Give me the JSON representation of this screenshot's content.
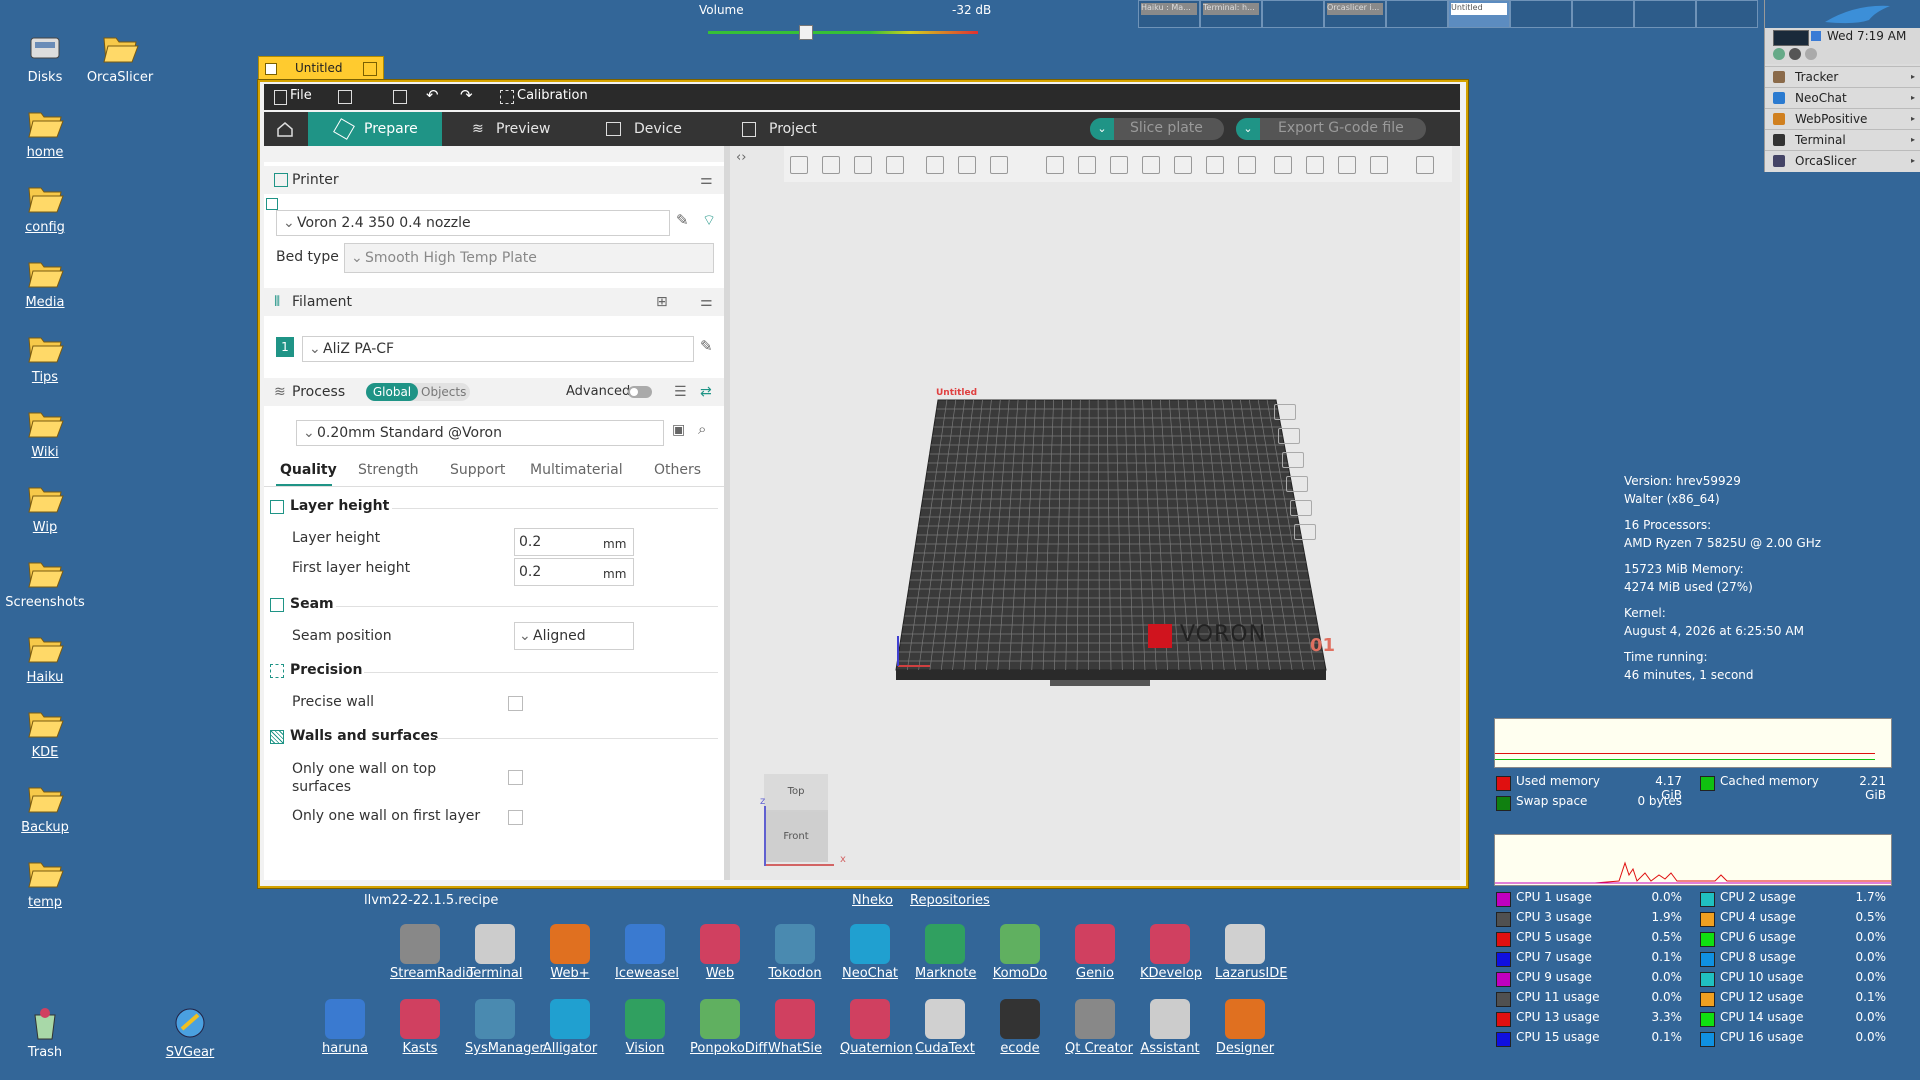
{
  "desktop": {
    "icons": [
      {
        "label": "Disks",
        "underline": false,
        "icon": "disk-icon"
      },
      {
        "label": "OrcaSlicer",
        "underline": false,
        "icon": "folder-icon"
      },
      {
        "label": "home",
        "underline": true,
        "icon": "folder-icon"
      },
      {
        "label": "config",
        "underline": true,
        "icon": "folder-icon"
      },
      {
        "label": "Media",
        "underline": true,
        "icon": "folder-icon"
      },
      {
        "label": "Tips",
        "underline": true,
        "icon": "folder-icon"
      },
      {
        "label": "Wiki",
        "underline": true,
        "icon": "folder-icon"
      },
      {
        "label": "Wip",
        "underline": true,
        "icon": "folder-icon"
      },
      {
        "label": "Screenshots",
        "underline": false,
        "icon": "folder-icon"
      },
      {
        "label": "Haiku",
        "underline": true,
        "icon": "folder-icon"
      },
      {
        "label": "KDE",
        "underline": true,
        "icon": "folder-icon"
      },
      {
        "label": "Backup",
        "underline": true,
        "icon": "folder-icon"
      },
      {
        "label": "temp",
        "underline": true,
        "icon": "folder-icon"
      },
      {
        "label": "Trash",
        "underline": false,
        "icon": "trash-icon"
      },
      {
        "label": "SVGear",
        "underline": true,
        "icon": "svgear-icon"
      }
    ]
  },
  "volume": {
    "label": "Volume",
    "value_label": "-32 dB",
    "level": 0.36
  },
  "workspaces": {
    "thumbs": [
      "Haiku : Ma...",
      "Terminal: h...",
      "",
      "Orcaslicer i...",
      "",
      "Untitled",
      "",
      "",
      "",
      ""
    ]
  },
  "deskbar": {
    "clock": "Wed 7:19 AM",
    "items": [
      "Tracker",
      "NeoChat",
      "WebPositive",
      "Terminal",
      "OrcaSlicer"
    ]
  },
  "window": {
    "title": "Untitled",
    "menubar": {
      "file": "File",
      "calibration": "Calibration"
    },
    "tabs": {
      "home": "",
      "prepare": "Prepare",
      "preview": "Preview",
      "device": "Device",
      "project": "Project"
    },
    "slice_button": "Slice plate",
    "export_button": "Export G-code file",
    "printer": {
      "section": "Printer",
      "preset": "Voron 2.4 350 0.4 nozzle",
      "bed_type_label": "Bed type",
      "bed_type": "Smooth High Temp Plate"
    },
    "filament": {
      "section": "Filament",
      "index": "1",
      "preset": "AliZ PA-CF"
    },
    "process": {
      "section": "Process",
      "global": "Global",
      "objects": "Objects",
      "advanced": "Advanced",
      "preset": "0.20mm Standard @Voron",
      "subtabs": [
        "Quality",
        "Strength",
        "Support",
        "Multimaterial",
        "Others"
      ]
    },
    "quality": {
      "layer_height_group": "Layer height",
      "layer_height_label": "Layer height",
      "layer_height_value": "0.2",
      "layer_height_unit": "mm",
      "first_layer_label": "First layer height",
      "first_layer_value": "0.2",
      "first_layer_unit": "mm",
      "seam_group": "Seam",
      "seam_position_label": "Seam position",
      "seam_position_value": "Aligned",
      "precision_group": "Precision",
      "precise_wall_label": "Precise wall",
      "walls_group": "Walls and surfaces",
      "one_wall_top_label": "Only one wall on top surfaces",
      "one_wall_first_label": "Only one wall on first layer"
    },
    "viewport": {
      "plate_label": "Untitled",
      "plate_number": "01",
      "brand": "VORON",
      "cube_top": "Top",
      "cube_front": "Front",
      "axis_x": "x",
      "axis_z": "z"
    }
  },
  "statusbar": {
    "recipe": "llvm22-22.1.5.recipe",
    "nheko": "Nheko",
    "repositories": "Repositories"
  },
  "sysinfo": {
    "lines": [
      "Version: hrev59929",
      "Walter (x86_64)",
      "",
      "16 Processors:",
      "AMD Ryzen 7 5825U @ 2.00 GHz",
      "",
      "15723 MiB Memory:",
      "4274 MiB used (27%)",
      "",
      "Kernel:",
      "August 4, 2026 at 6:25:50 AM",
      "",
      "Time running:",
      "46 minutes, 1 second"
    ]
  },
  "memory_legend": [
    {
      "label": "Used memory",
      "value": "4.17 GiB",
      "color": "#e01010"
    },
    {
      "label": "Cached memory",
      "value": "2.21 GiB",
      "color": "#10c010"
    },
    {
      "label": "Swap space",
      "value": "0 bytes",
      "color": "#108010"
    }
  ],
  "cpu_legend": [
    {
      "label": "CPU 1 usage",
      "value": "0.0%",
      "color": "#c000c0"
    },
    {
      "label": "CPU 2 usage",
      "value": "1.7%",
      "color": "#20c0c0"
    },
    {
      "label": "CPU 3 usage",
      "value": "1.9%",
      "color": "#505050"
    },
    {
      "label": "CPU 4 usage",
      "value": "0.5%",
      "color": "#f0a020"
    },
    {
      "label": "CPU 5 usage",
      "value": "0.5%",
      "color": "#e01010"
    },
    {
      "label": "CPU 6 usage",
      "value": "0.0%",
      "color": "#10e010"
    },
    {
      "label": "CPU 7 usage",
      "value": "0.1%",
      "color": "#1010e0"
    },
    {
      "label": "CPU 8 usage",
      "value": "0.0%",
      "color": "#1090e0"
    },
    {
      "label": "CPU 9 usage",
      "value": "0.0%",
      "color": "#c000c0"
    },
    {
      "label": "CPU 10 usage",
      "value": "0.0%",
      "color": "#20c0c0"
    },
    {
      "label": "CPU 11 usage",
      "value": "0.0%",
      "color": "#505050"
    },
    {
      "label": "CPU 12 usage",
      "value": "0.1%",
      "color": "#f0a020"
    },
    {
      "label": "CPU 13 usage",
      "value": "3.3%",
      "color": "#e01010"
    },
    {
      "label": "CPU 14 usage",
      "value": "0.0%",
      "color": "#10e010"
    },
    {
      "label": "CPU 15 usage",
      "value": "0.1%",
      "color": "#1010e0"
    },
    {
      "label": "CPU 16 usage",
      "value": "0.0%",
      "color": "#1090e0"
    }
  ],
  "launcher_row1": [
    "StreamRadio",
    "Terminal",
    "Web+",
    "Iceweasel",
    "Web",
    "Tokodon",
    "NeoChat",
    "Marknote",
    "KomoDo",
    "Genio",
    "KDevelop",
    "LazarusIDE"
  ],
  "launcher_row2": [
    "haruna",
    "Kasts",
    "SysManager",
    "Alligator",
    "Vision",
    "PonpokoDiff",
    "WhatSie",
    "Quaternion",
    "CudaText",
    "ecode",
    "Qt Creator",
    "Assistant",
    "Designer"
  ],
  "colors": {
    "desktop": "#336698",
    "accent": "#1f9486",
    "window_border": "#ffcb2f"
  }
}
